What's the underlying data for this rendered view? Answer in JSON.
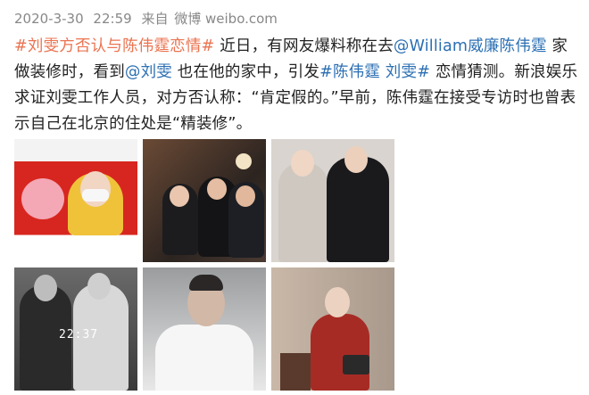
{
  "meta": {
    "date": "2020-3-30",
    "time": "22:59",
    "from_label": "来自",
    "source": "微博 weibo.com"
  },
  "post": {
    "topic1": "#刘雯方否认与陈伟霆恋情#",
    "t1": " 近日，有网友爆料称在去",
    "mention1": "@William威廉陈伟霆",
    "t2": " 家做装修时，看到",
    "mention2": "@刘雯",
    "t3": " 也在他的家中，引发",
    "topic2": "#陈伟霆 刘雯#",
    "t4": " 恋情猜测。新浪娱乐求证刘雯工作人员，对方否认称：“肯定假的。”早前，陈伟霆在接受专访时也曾表示自己在北京的住处是“精装修”。"
  },
  "images": [
    {
      "icon": "red-promo-photo"
    },
    {
      "icon": "interior-group-photo"
    },
    {
      "icon": "fashion-duo-photo"
    },
    {
      "icon": "bw-couple-photo",
      "overlay_text": "22:37"
    },
    {
      "icon": "towel-portrait-photo"
    },
    {
      "icon": "red-outfit-photo"
    }
  ],
  "colors": {
    "topic": "#eb7350",
    "mention": "#2b6fb3",
    "meta": "#888888"
  }
}
